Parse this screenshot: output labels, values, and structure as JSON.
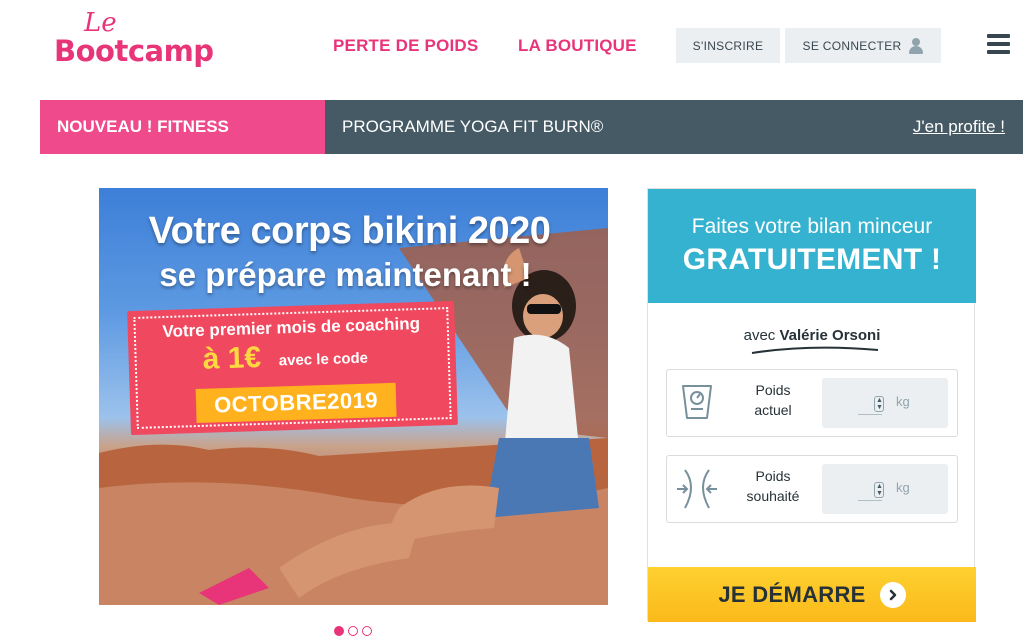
{
  "header": {
    "logo_le": "Le",
    "logo_main": "Bootcamp",
    "nav": [
      {
        "label": "PERTE DE POIDS"
      },
      {
        "label": "LA BOUTIQUE"
      }
    ],
    "signup_label": "S'INSCRIRE",
    "login_label": "SE CONNECTER",
    "menu_icon": "hamburger-icon",
    "user_icon": "user-icon"
  },
  "banner": {
    "tag": "NOUVEAU ! FITNESS",
    "program": "PROGRAMME YOGA FIT BURN®",
    "cta": "J'en profite !",
    "colors": {
      "tag_bg": "#ef4a8b",
      "bar_bg": "#455a64"
    }
  },
  "hero": {
    "line1": "Votre corps bikini 2020",
    "line2": "se prépare maintenant !",
    "promo_line1": "Votre premier mois de coaching",
    "promo_price": "à 1€",
    "promo_code_intro": "avec le code",
    "promo_code": "OCTOBRE2019",
    "carousel": {
      "total": 3,
      "active": 1
    }
  },
  "side_panel": {
    "title_line1": "Faites votre bilan minceur",
    "title_line2": "GRATUITEMENT !",
    "with_prefix": "avec",
    "with_name": "Valérie Orsoni",
    "fields": [
      {
        "label_line1": "Poids",
        "label_line2": "actuel",
        "unit": "kg",
        "value": "",
        "icon": "scale-icon"
      },
      {
        "label_line1": "Poids",
        "label_line2": "souhaité",
        "unit": "kg",
        "value": "",
        "icon": "waist-icon"
      }
    ],
    "start_label": "JE DÉMARRE",
    "colors": {
      "header_bg": "#35b2cf",
      "button_bg": "#fdc325",
      "accent": "#e8357a"
    }
  }
}
